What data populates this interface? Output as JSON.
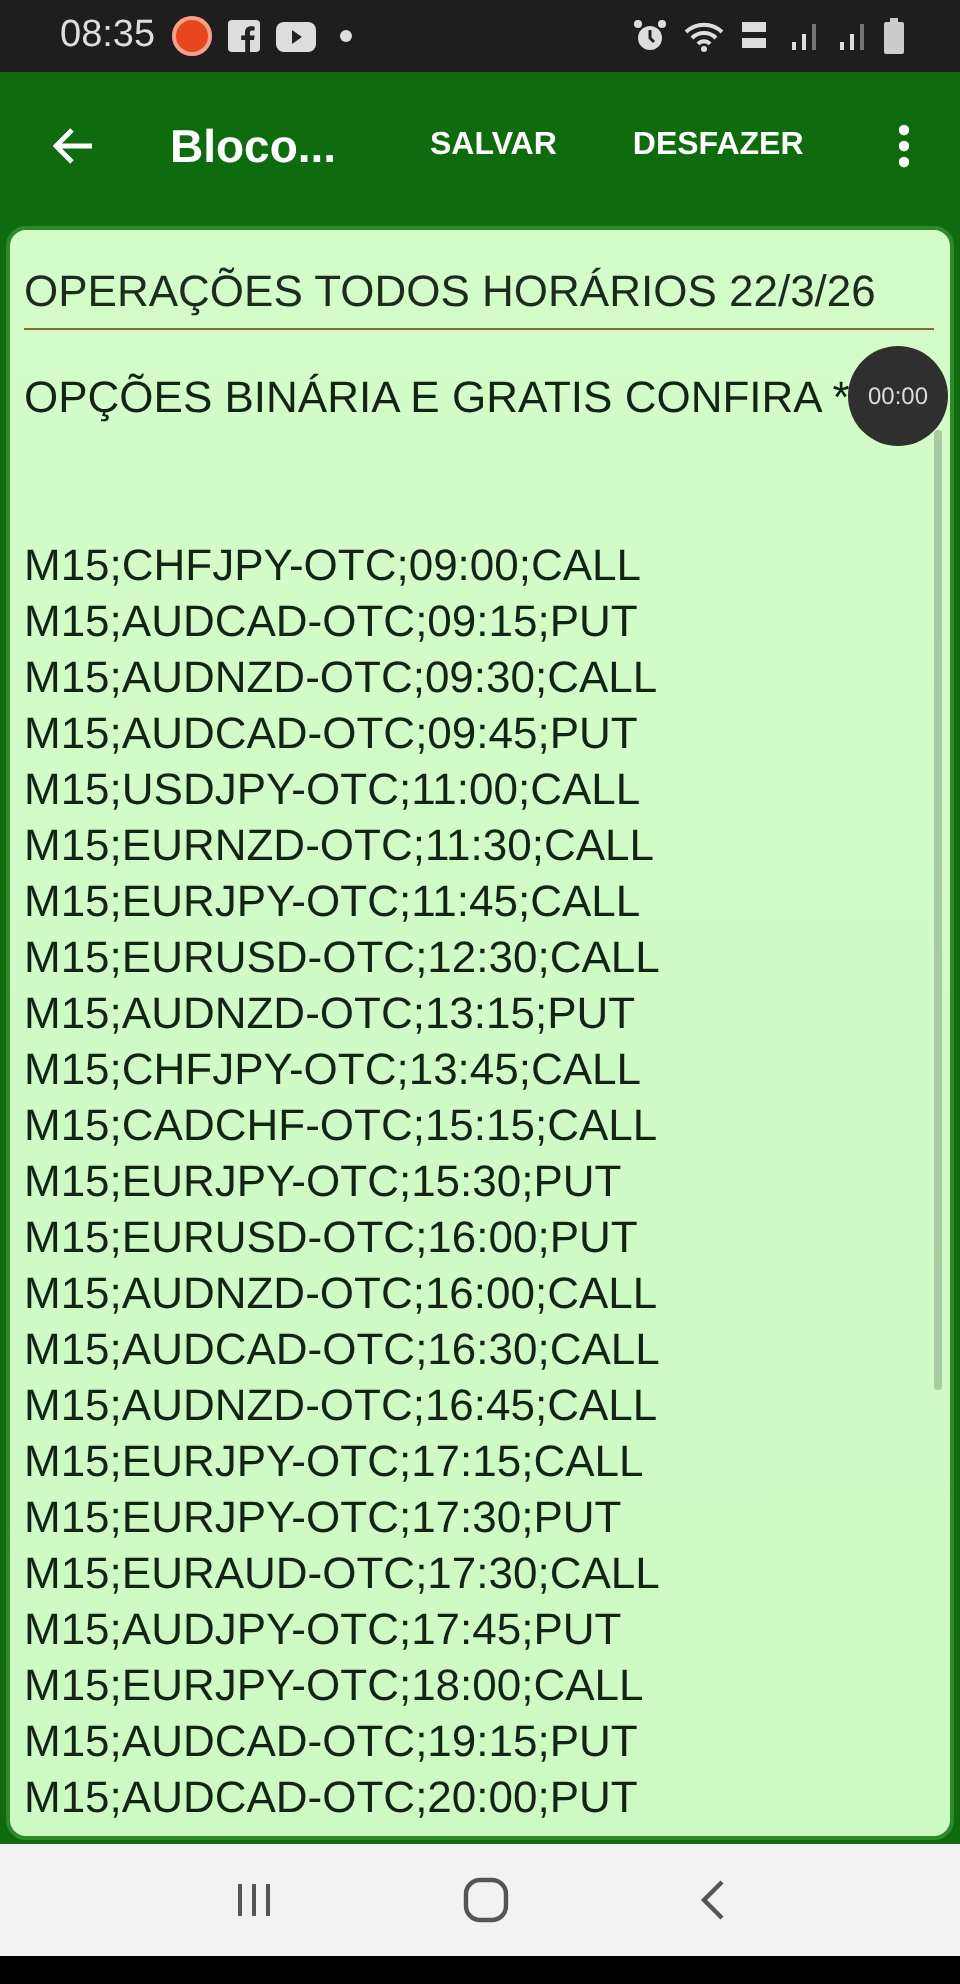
{
  "status_bar": {
    "time": "08:35"
  },
  "app_bar": {
    "title": "Bloco...",
    "actions": [
      "SALVAR",
      "DESFAZER"
    ]
  },
  "note": {
    "title": "OPERAÇÕES TODOS HORÁRIOS 22/3/26",
    "intro": "OPÇÕES BINÁRIA E GRATIS CONFIRA *",
    "lines": [
      "M15;CHFJPY-OTC;09:00;CALL",
      "M15;AUDCAD-OTC;09:15;PUT",
      "M15;AUDNZD-OTC;09:30;CALL",
      "M15;AUDCAD-OTC;09:45;PUT",
      "M15;USDJPY-OTC;11:00;CALL",
      "M15;EURNZD-OTC;11:30;CALL",
      "M15;EURJPY-OTC;11:45;CALL",
      "M15;EURUSD-OTC;12:30;CALL",
      "M15;AUDNZD-OTC;13:15;PUT",
      "M15;CHFJPY-OTC;13:45;CALL",
      "M15;CADCHF-OTC;15:15;CALL",
      "M15;EURJPY-OTC;15:30;PUT",
      "M15;EURUSD-OTC;16:00;PUT",
      "M15;AUDNZD-OTC;16:00;CALL",
      "M15;AUDCAD-OTC;16:30;CALL",
      "M15;AUDNZD-OTC;16:45;CALL",
      "M15;EURJPY-OTC;17:15;CALL",
      "M15;EURJPY-OTC;17:30;PUT",
      "M15;EURAUD-OTC;17:30;CALL",
      "M15;AUDJPY-OTC;17:45;PUT",
      "M15;EURJPY-OTC;18:00;CALL",
      "M15;AUDCAD-OTC;19:15;PUT",
      "M15;AUDCAD-OTC;20:00;PUT"
    ]
  },
  "timer": "00:00"
}
